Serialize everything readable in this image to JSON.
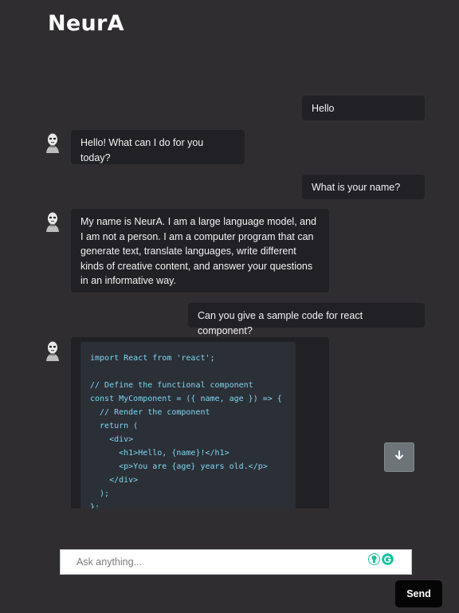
{
  "app": {
    "title": "NeurA"
  },
  "messages": {
    "user1": "Hello",
    "bot1": "Hello! What can I do for you today?",
    "user2": "What is your name?",
    "bot2": "My name is NeurA. I am a large language model, and I am not a person. I am a computer program that can generate text, translate languages, write different kinds of creative content, and answer your questions in an informative way.",
    "user3": "Can you give a sample code for react component?",
    "bot3_code": "import React from 'react';\n\n// Define the functional component\nconst MyComponent = ({ name, age }) => {\n  // Render the component\n  return (\n    <div>\n      <h1>Hello, {name}!</h1>\n      <p>You are {age} years old.</p>\n    </div>\n  );\n};"
  },
  "input": {
    "placeholder": "Ask anything..."
  },
  "buttons": {
    "send_label": "Send",
    "scroll_icon": "arrow-down-icon"
  },
  "icons": {
    "avatar": "robot-avatar-icon",
    "grammar_1": "lightbulb-icon",
    "grammar_2": "grammarly-icon"
  },
  "colors": {
    "bg": "#2f2d2f",
    "bubble": "#212125",
    "code_text": "#7fd7f4",
    "accent_green": "#15c39a"
  }
}
